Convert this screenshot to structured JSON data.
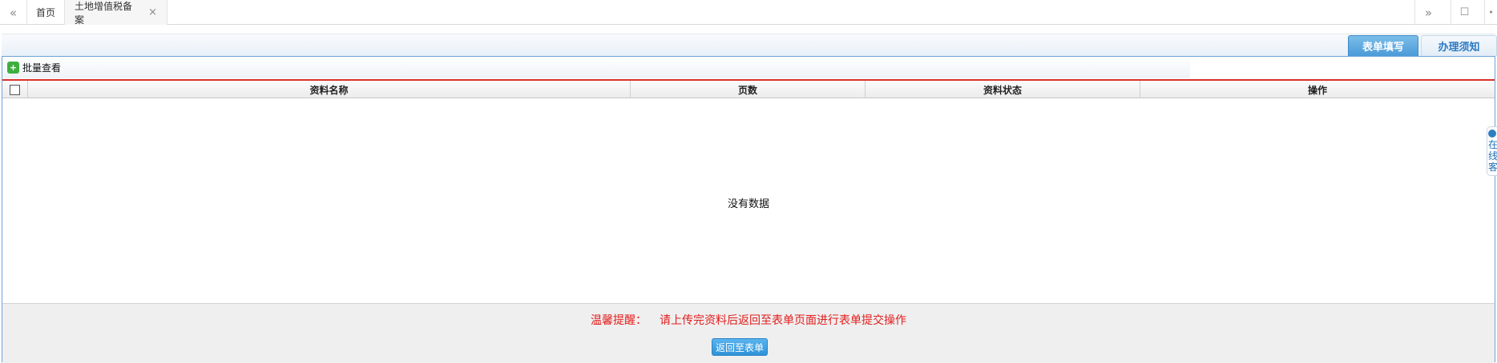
{
  "tabbar": {
    "nav_left": "«",
    "home_label": "首页",
    "active_tab_label": "土地增值税备案",
    "close_symbol": "×",
    "nav_right": "»",
    "window_symbol": "☐",
    "more_symbol": "•"
  },
  "top_tabs": {
    "form_label": "表单填写",
    "notice_label": "办理须知"
  },
  "toolbar": {
    "batch_view_label": "批量查看",
    "batch_icon_glyph": "+"
  },
  "table": {
    "columns": [
      "资料名称",
      "页数",
      "资料状态",
      "操作"
    ],
    "empty_text": "没有数据"
  },
  "footer": {
    "notice_label": "温馨提醒：",
    "notice_text": "请上传完资料后返回至表单页面进行表单提交操作",
    "back_button_label": "返回至表单"
  },
  "side_widget": {
    "text": "在线客"
  },
  "colors": {
    "accent_blue": "#4a9bd8",
    "notice_red": "#e31d1d",
    "divider_red": "#d9302b"
  }
}
